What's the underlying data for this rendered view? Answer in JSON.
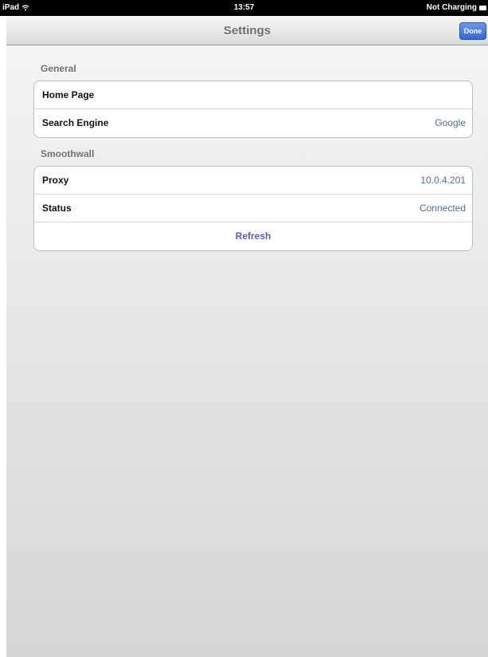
{
  "status_bar": {
    "device": "iPad",
    "time": "13:57",
    "charging": "Not Charging"
  },
  "nav": {
    "title": "Settings",
    "done_label": "Done"
  },
  "sections": {
    "general": {
      "header": "General",
      "home_page_label": "Home Page",
      "home_page_value": "",
      "search_engine_label": "Search Engine",
      "search_engine_value": "Google"
    },
    "smoothwall": {
      "header": "Smoothwall",
      "proxy_label": "Proxy",
      "proxy_value": "10.0.4.201",
      "status_label": "Status",
      "status_value": "Connected",
      "refresh_label": "Refresh"
    }
  },
  "icons": {
    "wifi": "wifi-icon",
    "battery": "battery-icon"
  },
  "colors": {
    "done_button": "#2f67d6",
    "value_text": "#4c6f9f",
    "refresh_text": "#5a5fb0"
  }
}
